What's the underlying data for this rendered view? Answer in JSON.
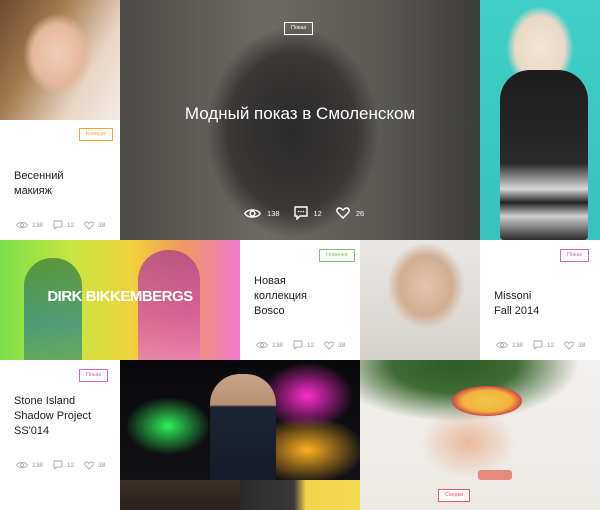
{
  "tiles": {
    "makeup": {
      "tag": "Конкурс",
      "title": "Весенний\nмакияж",
      "views": "138",
      "comments": "12",
      "likes": "38",
      "tag_color": "#f2a23a"
    },
    "hero": {
      "tag": "Показ",
      "title": "Модный показ в Смоленском",
      "views": "138",
      "comments": "12",
      "likes": "26"
    },
    "bosco": {
      "tag": "Новинки",
      "title": "Новая\nколлекция\nBosco",
      "views": "138",
      "comments": "12",
      "likes": "38",
      "tag_color": "#7cc46a"
    },
    "dirk": {
      "logo_text": "DIRK BIKKEMBERGS"
    },
    "missoni": {
      "tag": "Показ",
      "title": "Missoni\nFall 2014",
      "views": "138",
      "comments": "12",
      "likes": "38",
      "tag_color": "#d763c7"
    },
    "stone": {
      "tag": "Показ",
      "title": "Stone Island\nShadow Project\nSS'014",
      "views": "138",
      "comments": "12",
      "likes": "38",
      "tag_color": "#d763c7"
    },
    "sale": {
      "tag": "Скидки",
      "tag_color": "#e36060"
    }
  },
  "icons": {
    "views": "eye-icon",
    "comments": "comment-icon",
    "likes": "heart-icon"
  }
}
